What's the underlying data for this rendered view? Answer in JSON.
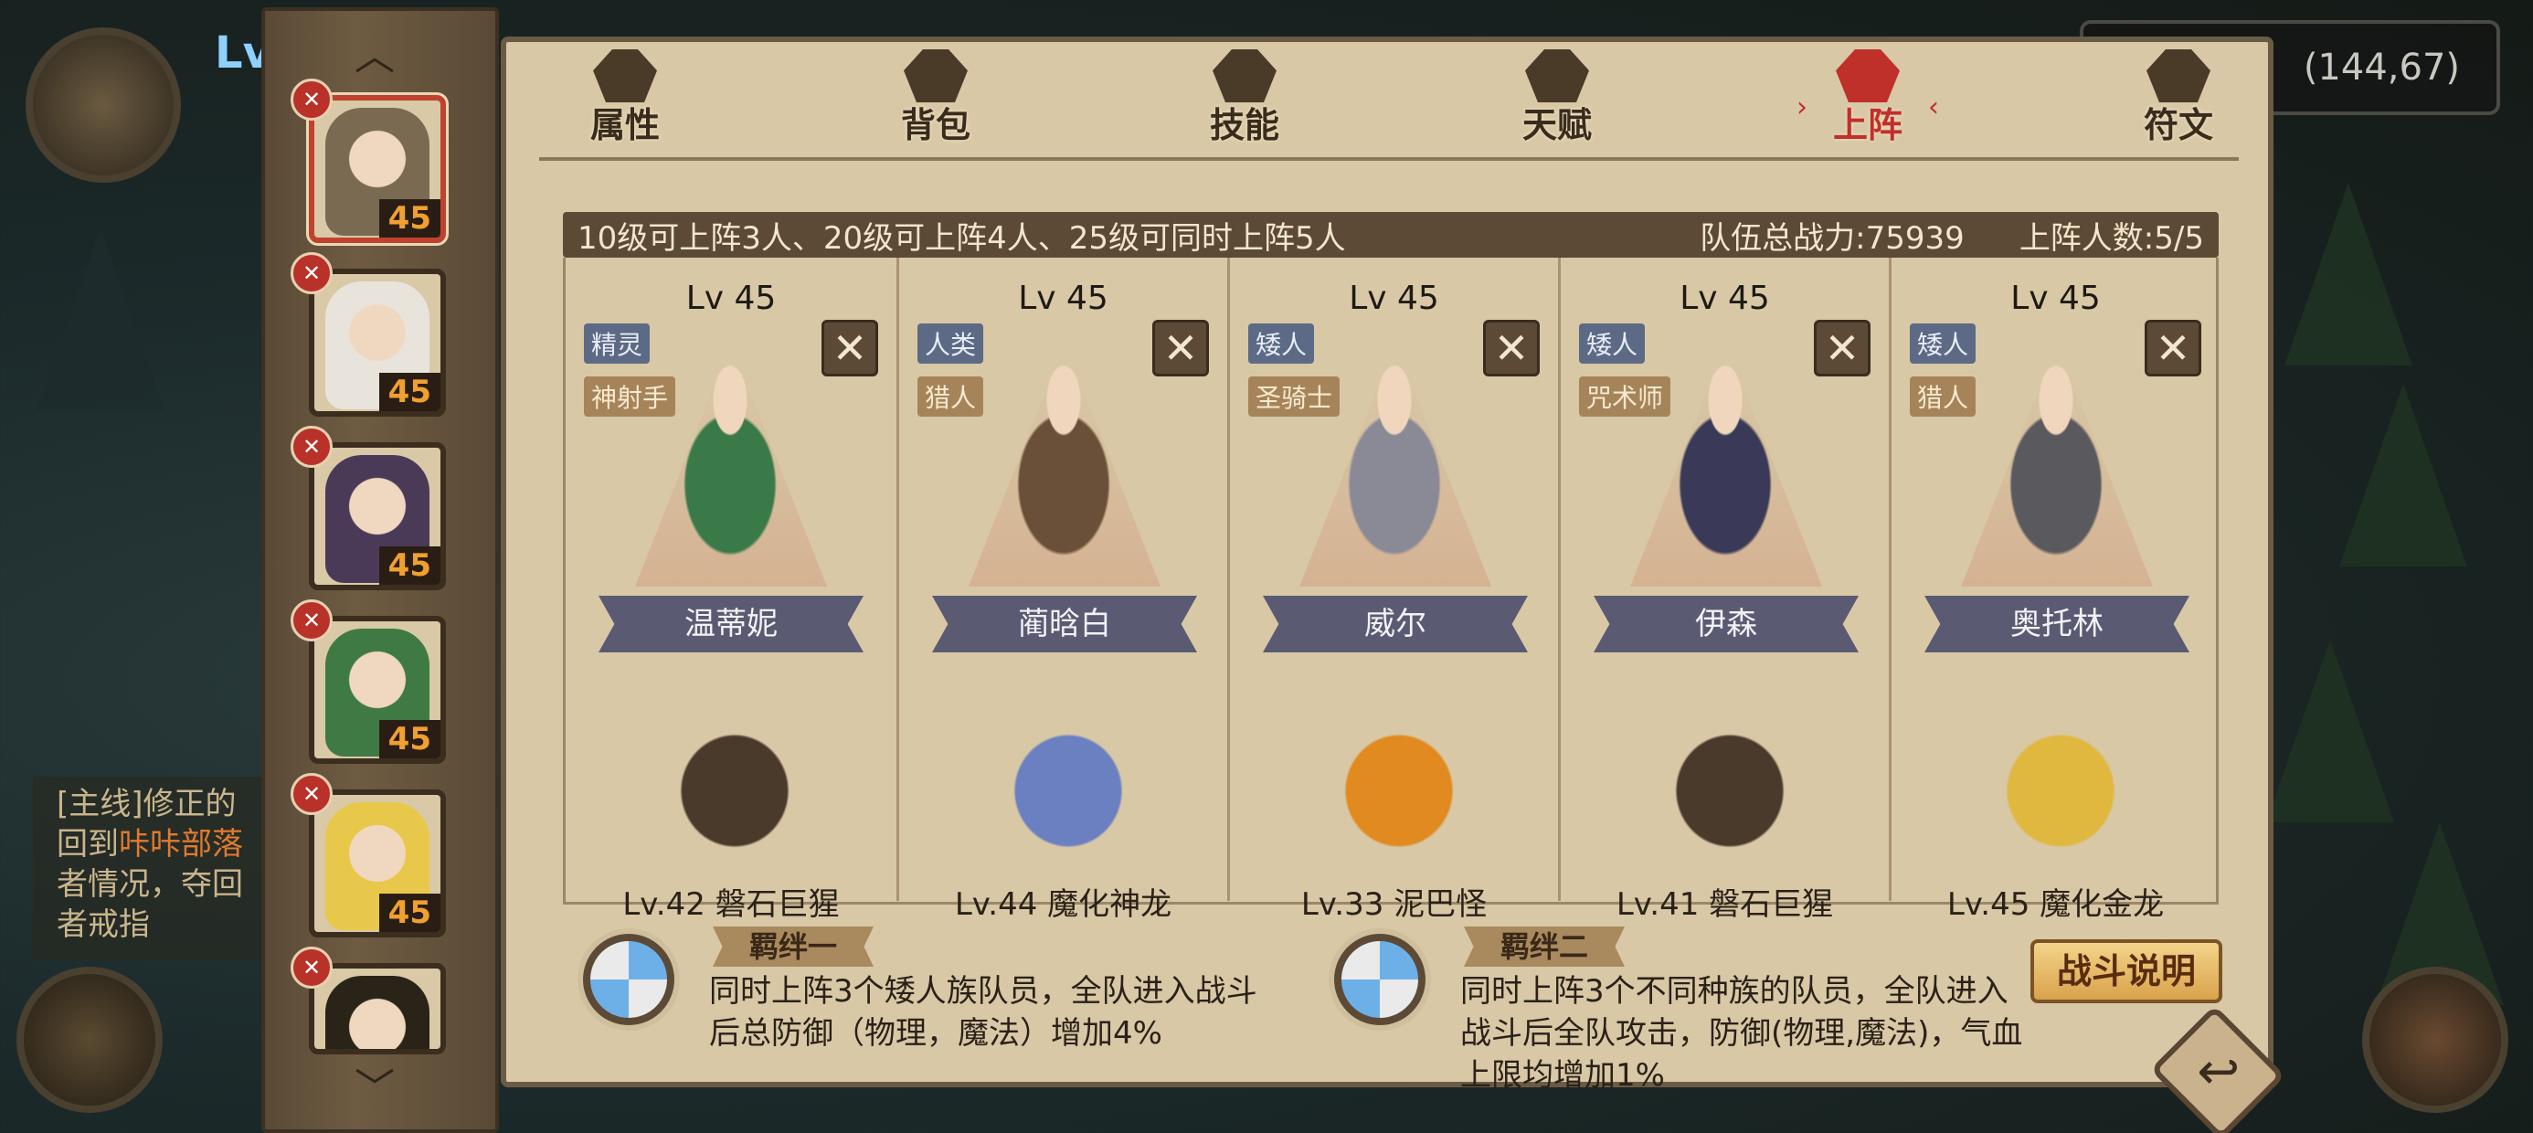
{
  "hud": {
    "coords": "(144,67)",
    "level_prefix": "Lv",
    "quest": {
      "line1": "[主线]修正的",
      "line2a": "回到",
      "line2b": "咔咔部落",
      "line3": "者情况，夺回",
      "line4": "者戒指"
    }
  },
  "roster": [
    {
      "level": "45",
      "badge": "✕",
      "color": "#7a6a52"
    },
    {
      "level": "45",
      "badge": "✕",
      "color": "#e8e4dc"
    },
    {
      "level": "45",
      "badge": "✕",
      "color": "#4a3a58"
    },
    {
      "level": "45",
      "badge": "✕",
      "color": "#3f7a44"
    },
    {
      "level": "45",
      "badge": "✕",
      "color": "#e8c84a"
    },
    {
      "level": "",
      "badge": "✕",
      "color": "#2a2418"
    }
  ],
  "tabs": [
    {
      "label": "属性",
      "icon": "flame-icon"
    },
    {
      "label": "背包",
      "icon": "backpack-icon"
    },
    {
      "label": "技能",
      "icon": "book-icon"
    },
    {
      "label": "天赋",
      "icon": "eye-icon"
    },
    {
      "label": "上阵",
      "icon": "crossed-swords-icon",
      "active": true
    },
    {
      "label": "符文",
      "icon": "rune-icon"
    }
  ],
  "info": {
    "rule": "10级可上阵3人、20级可上阵4人、25级可同时上阵5人",
    "power": "队伍总战力:75939",
    "count": "上阵人数:5/5"
  },
  "lineup": [
    {
      "lv": "Lv 45",
      "race": "精灵",
      "class": "神射手",
      "name": "温蒂妮",
      "pet": "Lv.42 磐石巨猩",
      "hero_color": "#3a7a48",
      "pet_color": "#4a3a2c"
    },
    {
      "lv": "Lv 45",
      "race": "人类",
      "class": "猎人",
      "name": "蔺晗白",
      "pet": "Lv.44 魔化神龙",
      "hero_color": "#6a5038",
      "pet_color": "#6a80c0"
    },
    {
      "lv": "Lv 45",
      "race": "矮人",
      "class": "圣骑士",
      "name": "威尔",
      "pet": "Lv.33 泥巴怪",
      "hero_color": "#8a8a96",
      "pet_color": "#e08a20"
    },
    {
      "lv": "Lv 45",
      "race": "矮人",
      "class": "咒术师",
      "name": "伊森",
      "pet": "Lv.41 磐石巨猩",
      "hero_color": "#3a3a58",
      "pet_color": "#4a3a2c"
    },
    {
      "lv": "Lv 45",
      "race": "矮人",
      "class": "猎人",
      "name": "奥托林",
      "pet": "Lv.45 魔化金龙",
      "hero_color": "#5a5a5e",
      "pet_color": "#e0b840"
    }
  ],
  "bonds": [
    {
      "title": "羁绊一",
      "line1": "同时上阵3个矮人族队员，全队进入战斗",
      "line2": "后总防御（物理，魔法）增加4%"
    },
    {
      "title": "羁绊二",
      "line1": "同时上阵3个不同种族的队员，全队进入",
      "line2": "战斗后全队攻击，防御(物理,魔法)，气血",
      "line3": "上限均增加1%"
    }
  ],
  "buttons": {
    "battle_info": "战斗说明"
  }
}
